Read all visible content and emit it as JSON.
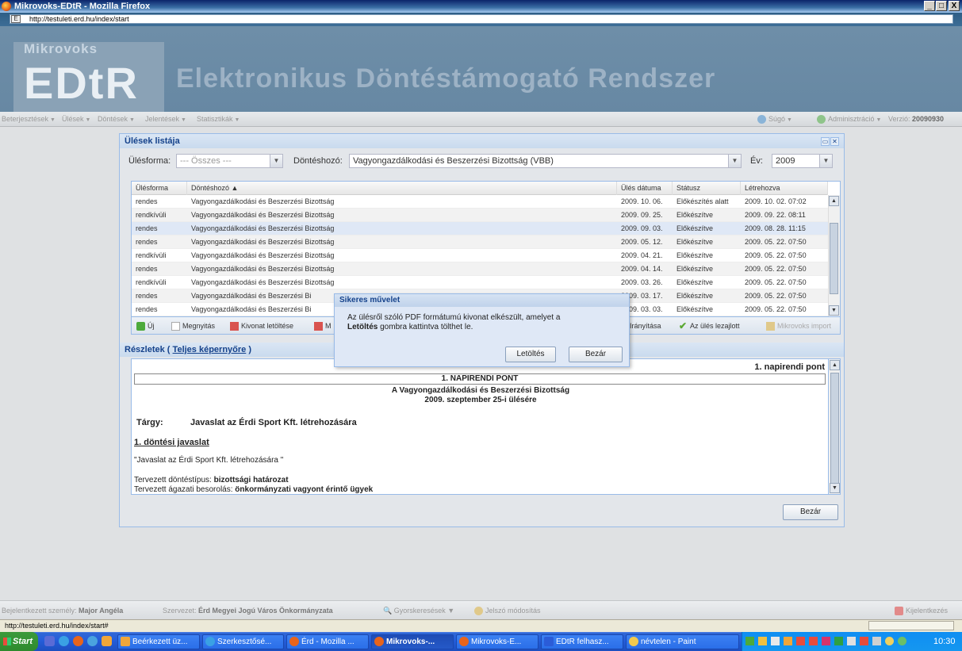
{
  "window": {
    "title": "Mikrovoks-EDtR - Mozilla Firefox",
    "min": "_",
    "max": "□",
    "close": "X",
    "url": "http://testuleti.erd.hu/index/start",
    "page_icon": "E",
    "bookmark_star": "☆"
  },
  "header": {
    "logo_small": "Mikrovoks",
    "logo_big": "EDtR",
    "title": "Elektronikus Döntéstámogató Rendszer"
  },
  "menu": {
    "left": [
      "Beterjesztések",
      "Ülések",
      "Döntések",
      "Jelentések",
      "Statisztikák"
    ],
    "help": "Súgó",
    "admin": "Adminisztráció",
    "version_label": "Verzió: ",
    "version_value": "20090930"
  },
  "panel": {
    "title": "Ülések listája",
    "filter": {
      "ulesforma_label": "Ülésforma:",
      "ulesforma_value": "--- Összes ---",
      "donteshozo_label": "Döntéshozó:",
      "donteshozo_value": "Vagyongazdálkodási és Beszerzési Bizottság (VBB)",
      "ev_label": "Év:",
      "ev_value": "2009"
    },
    "grid": {
      "columns": [
        "Ülésforma",
        "Döntéshozó ▲",
        "Ülés dátuma",
        "Státusz",
        "Létrehozva"
      ],
      "rows": [
        [
          "rendes",
          "Vagyongazdálkodási és Beszerzési Bizottság",
          "2009. 10. 06.",
          "Előkészítés alatt",
          "2009. 10. 02. 07:02"
        ],
        [
          "rendkívüli",
          "Vagyongazdálkodási és Beszerzési Bizottság",
          "2009. 09. 25.",
          "Előkészítve",
          "2009. 09. 22. 08:11"
        ],
        [
          "rendes",
          "Vagyongazdálkodási és Beszerzési Bizottság",
          "2009. 09. 03.",
          "Előkészítve",
          "2009. 08. 28. 11:15"
        ],
        [
          "rendes",
          "Vagyongazdálkodási és Beszerzési Bizottság",
          "2009. 05. 12.",
          "Előkészítve",
          "2009. 05. 22. 07:50"
        ],
        [
          "rendkívüli",
          "Vagyongazdálkodási és Beszerzési Bizottság",
          "2009. 04. 21.",
          "Előkészítve",
          "2009. 05. 22. 07:50"
        ],
        [
          "rendes",
          "Vagyongazdálkodási és Beszerzési Bizottság",
          "2009. 04. 14.",
          "Előkészítve",
          "2009. 05. 22. 07:50"
        ],
        [
          "rendkívüli",
          "Vagyongazdálkodási és Beszerzési Bizottság",
          "2009. 03. 26.",
          "Előkészítve",
          "2009. 05. 22. 07:50"
        ],
        [
          "rendes",
          "Vagyongazdálkodási és Beszerzési Bi",
          "2009. 03. 17.",
          "Előkészítve",
          "2009. 05. 22. 07:50"
        ],
        [
          "rendes",
          "Vagyongazdálkodási és Beszerzési Bi",
          "2009. 03. 03.",
          "Előkészítve",
          "2009. 05. 22. 07:50"
        ]
      ]
    },
    "toolbar": {
      "new": "Új",
      "open": "Megnyitás",
      "download": "Kivonat letöltése",
      "more": "M",
      "control": "Irányítása",
      "closed": "Az ülés lezajlott",
      "import": "Mikrovoks import"
    },
    "details": {
      "label": "Részletek (",
      "link": "Teljes képernyőre",
      "close_paren": ")",
      "point_label": "1. napirendi pont",
      "napi_title": "1. NAPIRENDI PONT",
      "subtitle1": "A Vagyongazdálkodási és Beszerzési Bizottság",
      "subtitle2": "2009. szeptember 25-i ülésére",
      "targy_label": "Tárgy:",
      "targy_value": "Javaslat az Érdi Sport Kft. létrehozására",
      "proposal_heading": "1. döntési javaslat",
      "quote": "\"Javaslat az Érdi Sport Kft. létrehozására \"",
      "type_label": "Tervezett döntéstípus: ",
      "type_value": "bizottsági határozat",
      "sector_label": "Tervezett ágazati besorolás: ",
      "sector_value": "önkormányzati vagyont érintő ügyek"
    },
    "close_button": "Bezár"
  },
  "dialog": {
    "title": "Sikeres művelet",
    "msg_line1": "Az ülésről szóló PDF formátumú kivonat elkészült, amelyet a",
    "msg_bold": "Letöltés",
    "msg_line2": " gombra kattintva tölthet le.",
    "download_button": "Letöltés",
    "close_button": "Bezár"
  },
  "statusbar": {
    "user_label": "Bejelentkezett személy: ",
    "user": "Major Angéla",
    "org_label": "Szervezet: ",
    "org": "Érd Megyei Jogú Város Önkormányzata",
    "quick": "Gyorskeresések",
    "password": "Jelszó módosítás",
    "logout": "Kijelentkezés"
  },
  "browser_status": "http://testuleti.erd.hu/index/start#",
  "taskbar": {
    "start": "Start",
    "tasks": [
      "Beérkezett üz...",
      "Szerkesztősé...",
      "Érd - Mozilla ...",
      "Mikrovoks-...",
      "Mikrovoks-E...",
      "EDtR felhasz...",
      "névtelen - Paint"
    ],
    "clock": "10:30"
  }
}
